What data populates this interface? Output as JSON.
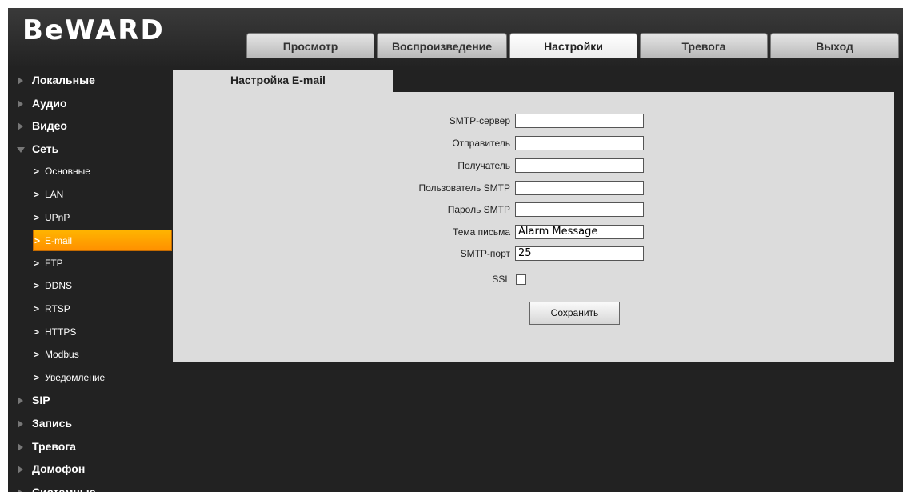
{
  "brand": {
    "logo": "BeWARD"
  },
  "tabs": [
    "Просмотр",
    "Воспроизведение",
    "Настройки",
    "Тревога",
    "Выход"
  ],
  "active_tab": "Настройки",
  "sidebar": {
    "items": [
      {
        "label": "Локальные",
        "level": "top",
        "state": "collapsed"
      },
      {
        "label": "Аудио",
        "level": "top",
        "state": "collapsed"
      },
      {
        "label": "Видео",
        "level": "top",
        "state": "collapsed"
      },
      {
        "label": "Сеть",
        "level": "top",
        "state": "expanded"
      },
      {
        "label": "Основные",
        "level": "sub"
      },
      {
        "label": "LAN",
        "level": "sub"
      },
      {
        "label": "UPnP",
        "level": "sub"
      },
      {
        "label": "E-mail",
        "level": "sub",
        "selected": true
      },
      {
        "label": "FTP",
        "level": "sub"
      },
      {
        "label": "DDNS",
        "level": "sub"
      },
      {
        "label": "RTSP",
        "level": "sub"
      },
      {
        "label": "HTTPS",
        "level": "sub"
      },
      {
        "label": "Modbus",
        "level": "sub"
      },
      {
        "label": "Уведомление",
        "level": "sub"
      },
      {
        "label": "SIP",
        "level": "top",
        "state": "collapsed"
      },
      {
        "label": "Запись",
        "level": "top",
        "state": "collapsed"
      },
      {
        "label": "Тревога",
        "level": "top",
        "state": "collapsed"
      },
      {
        "label": "Домофон",
        "level": "top",
        "state": "collapsed"
      },
      {
        "label": "Системные",
        "level": "top",
        "state": "collapsed"
      }
    ]
  },
  "content": {
    "tab_title": "Настройка E-mail",
    "fields": [
      {
        "label": "SMTP-сервер",
        "value": ""
      },
      {
        "label": "Отправитель",
        "value": ""
      },
      {
        "label": "Получатель",
        "value": ""
      },
      {
        "label": "Пользователь SMTP",
        "value": ""
      },
      {
        "label": "Пароль SMTP",
        "value": ""
      },
      {
        "label": "Тема письма",
        "value": "Alarm Message"
      },
      {
        "label": "SMTP-порт",
        "value": "25"
      }
    ],
    "ssl": {
      "label": "SSL",
      "checked": false
    },
    "save_label": "Сохранить"
  },
  "colors": {
    "background": "#222222",
    "panel": "#dcdcdc",
    "accent": "#ff9f00"
  }
}
